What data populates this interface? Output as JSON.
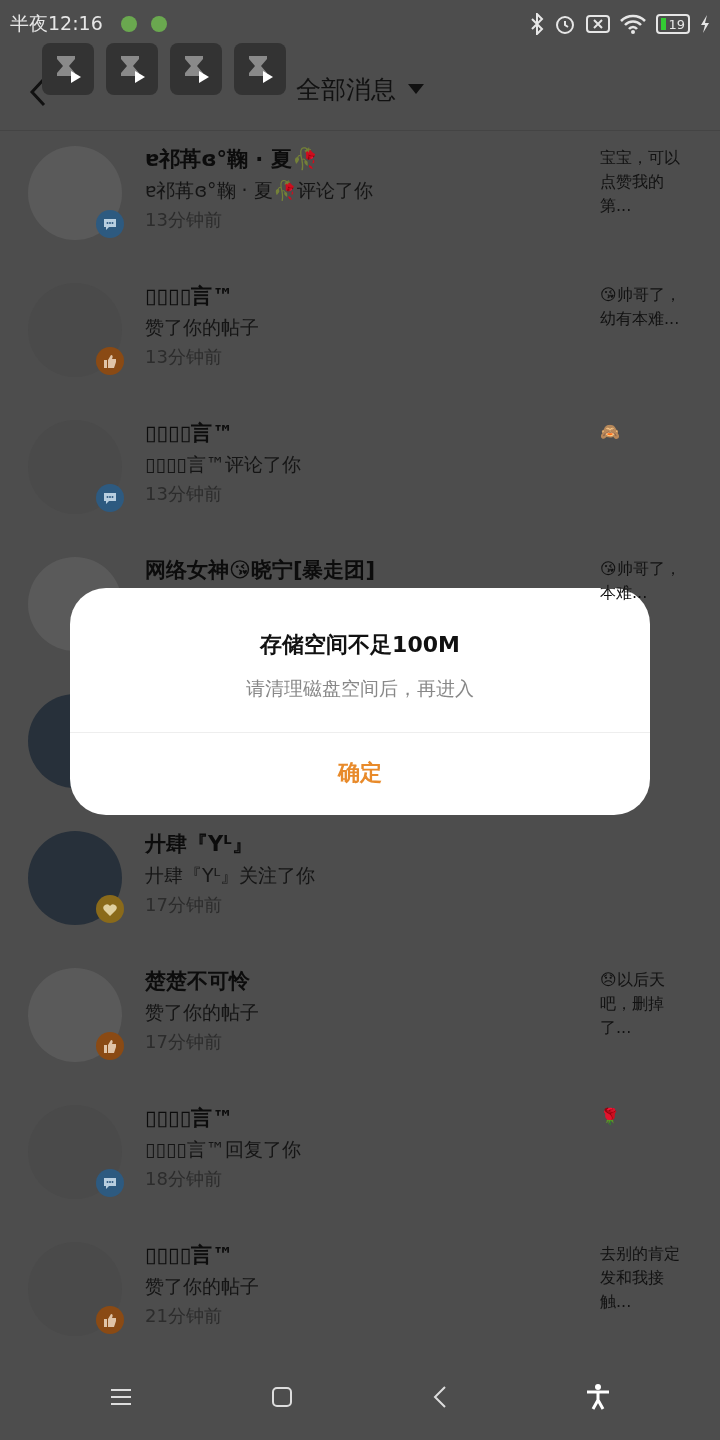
{
  "status_bar": {
    "time": "半夜12:16",
    "battery": "19"
  },
  "header": {
    "title": "全部消息"
  },
  "floating_apps": [
    {
      "kind": "hourglass"
    },
    {
      "kind": "hourglass"
    },
    {
      "kind": "hourglass"
    },
    {
      "kind": "hourglass"
    }
  ],
  "messages": [
    {
      "name": "ɐ祁苒ɞ°鞠 · 夏🥀",
      "action": "ɐ祁苒ɞ°鞠 · 夏🥀评论了你",
      "time": "13分钟前",
      "badge": {
        "kind": "comment"
      },
      "avatar": {
        "kind": "light"
      },
      "snippet_lines": [
        "宝宝，可以",
        "点赞我的",
        "第..."
      ]
    },
    {
      "name": "▯▯▯▯言™",
      "action": "赞了你的帖子",
      "time": "13分钟前",
      "badge": {
        "kind": "like"
      },
      "avatar": {
        "kind": "grey"
      },
      "snippet_lines": [
        "😘帅哥了，",
        "幼有本难..."
      ]
    },
    {
      "name": "▯▯▯▯言™",
      "action": "▯▯▯▯言™评论了你",
      "time": "13分钟前",
      "badge": {
        "kind": "comment"
      },
      "avatar": {
        "kind": "grey"
      },
      "snippet_lines": [
        "🙈"
      ]
    },
    {
      "name": "网络女神😘晓宁[暴走团]",
      "avatar": {
        "kind": "light"
      },
      "snippet_lines": [
        "😘帅哥了，",
        "本难..."
      ]
    },
    {
      "avatar": {
        "kind": "dark"
      }
    },
    {
      "name": "廾肆『Yᴸ』",
      "action": "廾肆『Yᴸ』关注了你",
      "time": "17分钟前",
      "badge": {
        "kind": "follow"
      },
      "avatar": {
        "kind": "dark"
      }
    },
    {
      "name": "楚楚不可怜",
      "action": "赞了你的帖子",
      "time": "17分钟前",
      "badge": {
        "kind": "like"
      },
      "avatar": {
        "kind": "light"
      },
      "snippet_lines": [
        "😞以后天",
        "吧，删掉",
        "了..."
      ]
    },
    {
      "name": "▯▯▯▯言™",
      "action": "▯▯▯▯言™回复了你",
      "time": "18分钟前",
      "badge": {
        "kind": "comment"
      },
      "avatar": {
        "kind": "grey"
      },
      "snippet_lines": [
        "🌹"
      ]
    },
    {
      "name": "▯▯▯▯言™",
      "action": "赞了你的帖子",
      "time": "21分钟前",
      "badge": {
        "kind": "like"
      },
      "avatar": {
        "kind": "grey"
      },
      "snippet_lines": [
        "去别的肯定",
        "发和我接",
        "触..."
      ]
    }
  ],
  "dialog": {
    "title": "存储空间不足100M",
    "message": "请清理磁盘空间后，再进入",
    "button": "确定"
  }
}
